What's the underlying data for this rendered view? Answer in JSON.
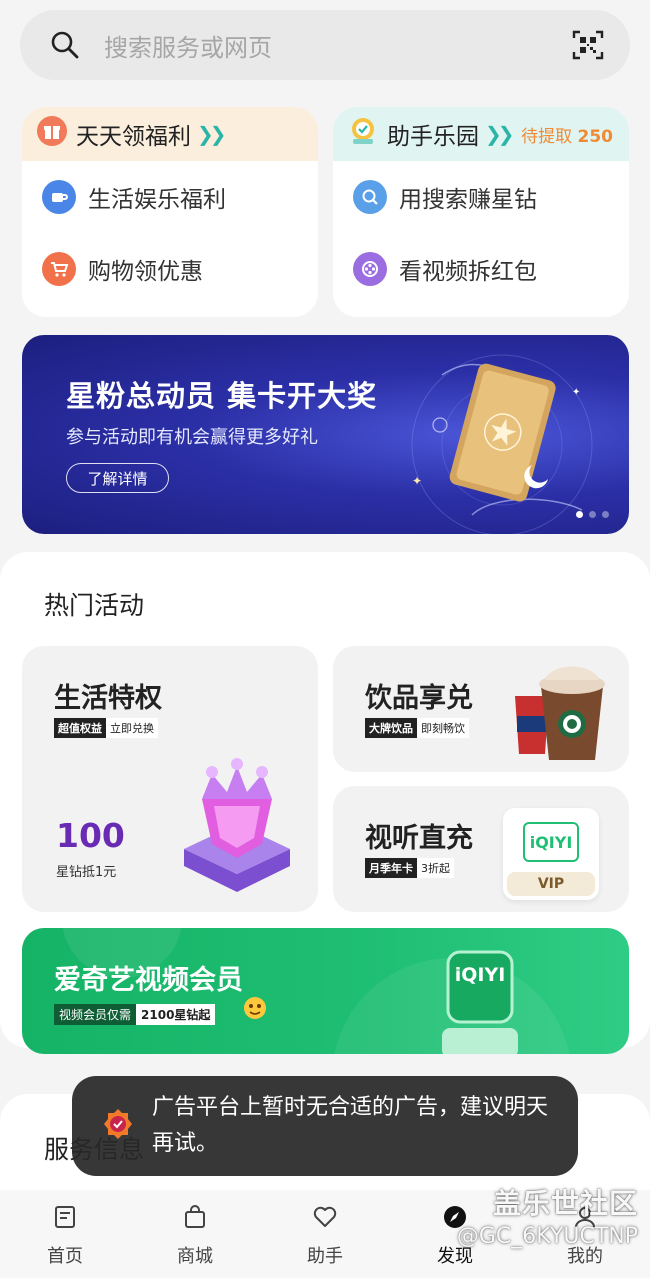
{
  "search": {
    "placeholder": "搜索服务或网页"
  },
  "welfare_card": {
    "title": "天天领福利",
    "items": [
      {
        "label": "生活娱乐福利"
      },
      {
        "label": "购物领优惠"
      }
    ]
  },
  "assistant_card": {
    "title": "助手乐园",
    "pending_label": "待提取",
    "pending_count": "250",
    "items": [
      {
        "label": "用搜索赚星钻"
      },
      {
        "label": "看视频拆红包"
      }
    ]
  },
  "banner": {
    "title": "星粉总动员 集卡开大奖",
    "subtitle": "参与活动即有机会赢得更多好礼",
    "button": "了解详情",
    "page_count": 3,
    "active_page": 1
  },
  "hot": {
    "title": "热门活动",
    "life": {
      "title": "生活特权",
      "tag_dark": "超值权益",
      "tag_light": "立即兑换",
      "value": "100",
      "value_sub": "星钻抵1元"
    },
    "drinks": {
      "title": "饮品享兑",
      "tag_dark": "大牌饮品",
      "tag_light": "即刻畅饮"
    },
    "video": {
      "title": "视听直充",
      "tag_dark": "月季年卡",
      "tag_light": "3折起",
      "brand": "iQIYI",
      "badge": "VIP"
    },
    "iqiyi": {
      "title": "爱奇艺视频会员",
      "tag_dark": "视频会员仅需",
      "tag_light": "2100星钻起",
      "brand": "iQIYI"
    }
  },
  "service": {
    "title": "服务信息"
  },
  "toast": {
    "message": "广告平台上暂时无合适的广告，建议明天再试。"
  },
  "nav": [
    {
      "label": "首页",
      "icon": "home-icon"
    },
    {
      "label": "商城",
      "icon": "shop-bag-icon"
    },
    {
      "label": "助手",
      "icon": "heart-icon"
    },
    {
      "label": "发现",
      "icon": "compass-icon"
    },
    {
      "label": "我的",
      "icon": "person-icon"
    }
  ],
  "watermark": {
    "line1": "盖乐世社区",
    "line2": "@GC_6KYUCTNP"
  },
  "colors": {
    "accent_teal": "#2bb5a8",
    "pending_orange": "#ef8b36",
    "iqiyi_green": "#1fbf74",
    "banner_blue": "#2b2fa6"
  }
}
